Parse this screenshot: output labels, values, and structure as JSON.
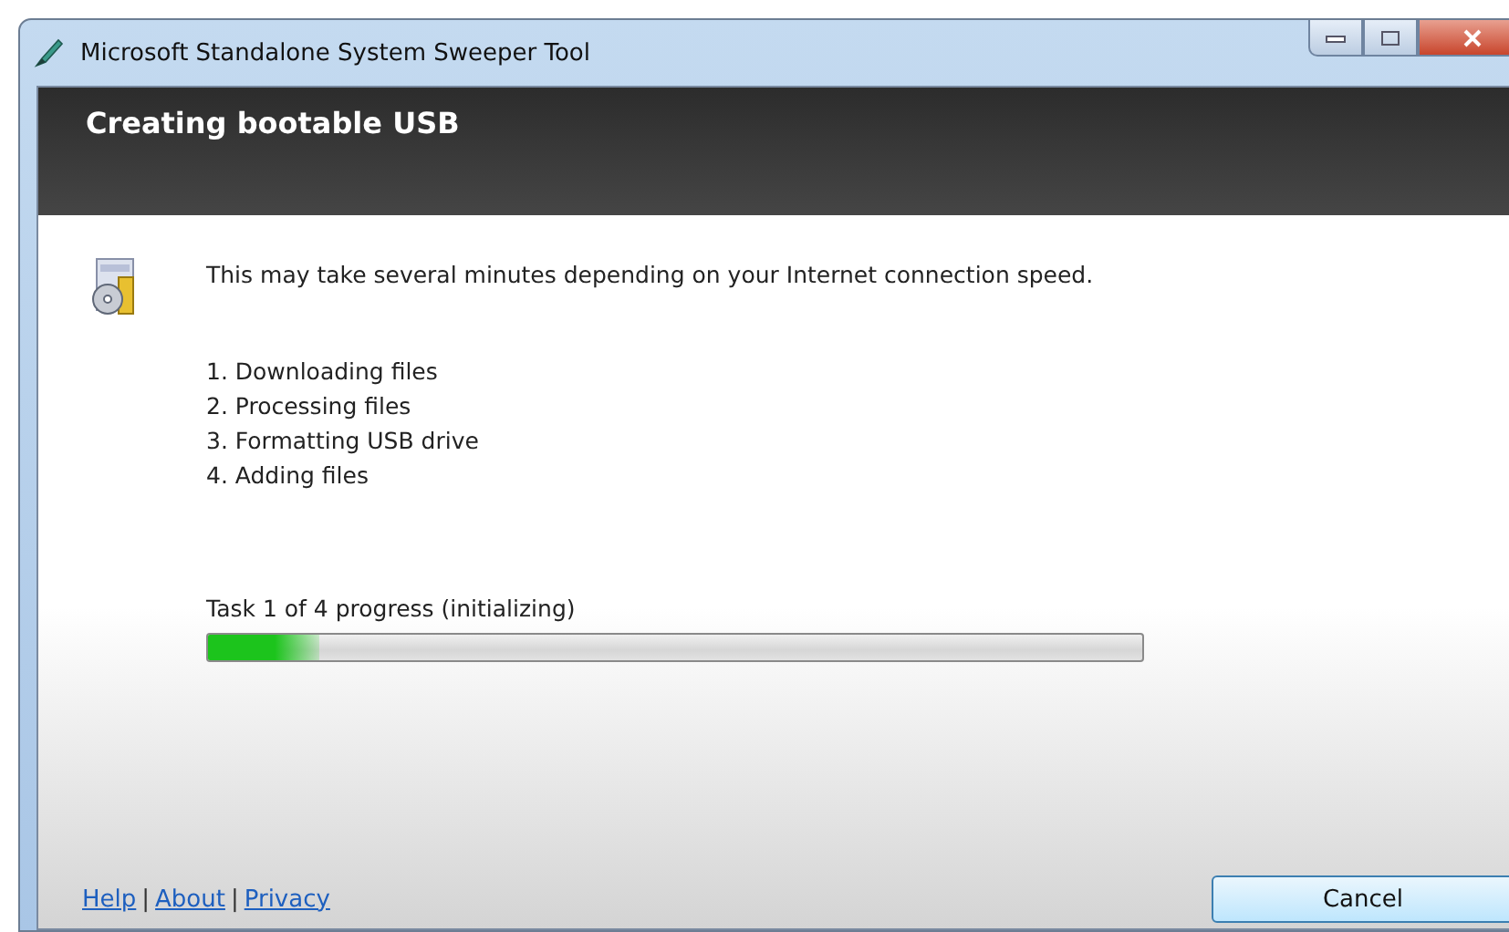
{
  "window": {
    "title": "Microsoft Standalone System Sweeper Tool"
  },
  "header": {
    "title": "Creating bootable USB"
  },
  "message": "This may take several minutes depending on your Internet connection speed.",
  "steps": [
    "1. Downloading files",
    "2. Processing files",
    "3. Formatting USB drive",
    "4. Adding files"
  ],
  "progress": {
    "label": "Task 1 of 4 progress (initializing)",
    "level": 0.12
  },
  "footer_links": [
    {
      "kind": "link",
      "text": "Help"
    },
    {
      "kind": "separator",
      "text": "|"
    },
    {
      "kind": "link",
      "text": "About"
    },
    {
      "kind": "separator",
      "text": "|"
    },
    {
      "kind": "link",
      "text": "Privacy"
    }
  ],
  "buttons": [
    "Cancel"
  ]
}
